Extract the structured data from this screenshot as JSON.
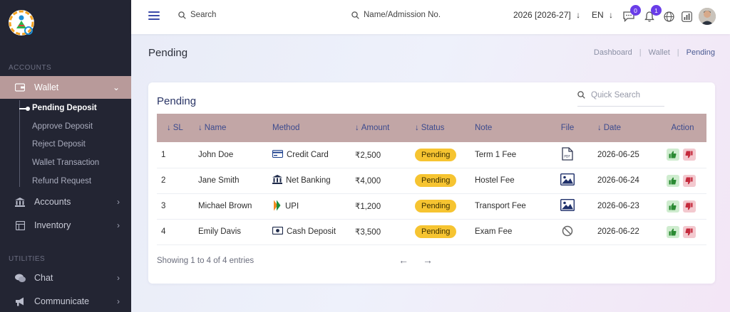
{
  "sidebar": {
    "section_accounts": "ACCOUNTS",
    "section_utilities": "UTILITIES",
    "items": [
      {
        "label": "Wallet"
      },
      {
        "label": "Accounts"
      },
      {
        "label": "Inventory"
      },
      {
        "label": "Chat"
      },
      {
        "label": "Communicate"
      }
    ],
    "submenu": [
      "Pending Deposit",
      "Approve Deposit",
      "Reject Deposit",
      "Wallet Transaction",
      "Refund Request"
    ]
  },
  "topbar": {
    "search_label": "Search",
    "name_search_label": "Name/Admission No.",
    "session": "2026 [2026-27]",
    "language": "EN",
    "chat_badge": "0",
    "notif_badge": "1"
  },
  "page": {
    "title": "Pending",
    "breadcrumb": [
      "Dashboard",
      "Wallet",
      "Pending"
    ]
  },
  "card": {
    "title": "Pending",
    "quick_search_placeholder": "Quick Search",
    "columns": [
      "SL",
      "Name",
      "Method",
      "Amount",
      "Status",
      "Note",
      "File",
      "Date",
      "Action"
    ],
    "rows": [
      {
        "sl": "1",
        "name": "John Doe",
        "method": "Credit Card",
        "amount": "₹2,500",
        "status": "Pending",
        "note": "Term 1 Fee",
        "file": "pdf",
        "date": "2026-06-25"
      },
      {
        "sl": "2",
        "name": "Jane Smith",
        "method": "Net Banking",
        "amount": "₹4,000",
        "status": "Pending",
        "note": "Hostel Fee",
        "file": "image",
        "date": "2026-06-24"
      },
      {
        "sl": "3",
        "name": "Michael Brown",
        "method": "UPI",
        "amount": "₹1,200",
        "status": "Pending",
        "note": "Transport Fee",
        "file": "image",
        "date": "2026-06-23"
      },
      {
        "sl": "4",
        "name": "Emily Davis",
        "method": "Cash Deposit",
        "amount": "₹3,500",
        "status": "Pending",
        "note": "Exam Fee",
        "file": "none",
        "date": "2026-06-22"
      }
    ],
    "showing": "Showing 1 to 4 of 4 entries"
  },
  "colors": {
    "sidebar_bg": "#232533",
    "active_menu": "#b89a9a",
    "table_header": "#c2a6a6",
    "status_pill": "#f6c431",
    "badge": "#6a3de8",
    "accent": "#3b4aa8"
  }
}
